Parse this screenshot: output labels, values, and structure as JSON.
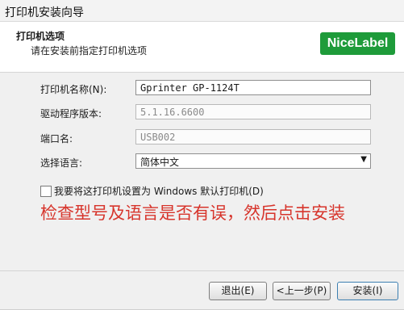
{
  "window": {
    "title": "打印机安装向导"
  },
  "header": {
    "heading": "打印机选项",
    "subtitle": "请在安装前指定打印机选项",
    "logo_text": "NiceLabel",
    "logo_color": "#1e9b3a"
  },
  "form": {
    "printer_name_label": "打印机名称(N):",
    "printer_name_value": "Gprinter GP-1124T",
    "driver_version_label": "驱动程序版本:",
    "driver_version_value": "5.1.16.6600",
    "port_label": "端口名:",
    "port_value": "USB002",
    "language_label": "选择语言:",
    "language_value": "简体中文",
    "default_printer_label": "我要将这打印机设置为 Windows 默认打印机(D)",
    "default_printer_checked": false
  },
  "annotation": {
    "text": "检查型号及语言是否有误，然后点击安装",
    "color": "#d7352c"
  },
  "buttons": {
    "exit": "退出(E)",
    "back": "<上一步(P)",
    "install": "安装(I)"
  }
}
